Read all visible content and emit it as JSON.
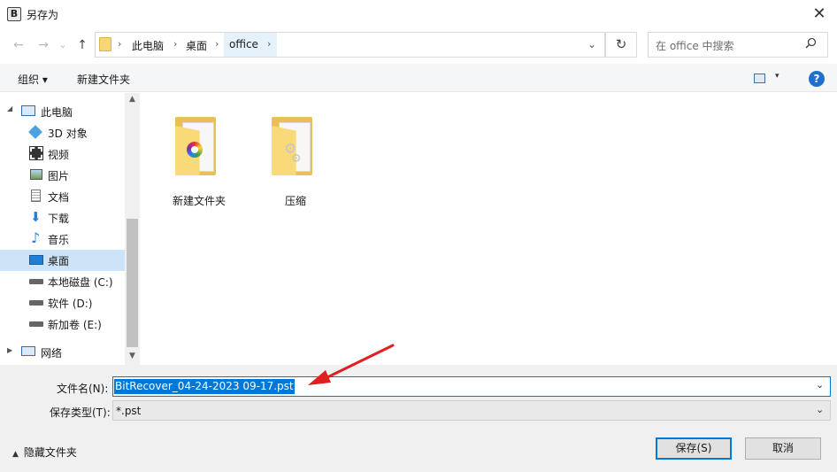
{
  "window": {
    "app_icon_letter": "B",
    "title": "另存为",
    "close_glyph": "✕"
  },
  "address_bar": {
    "back_glyph": "←",
    "forward_glyph": "→",
    "recent_glyph": "⌄",
    "up_glyph": "↑",
    "breadcrumbs": [
      "此电脑",
      "桌面",
      "office"
    ],
    "separator": "›",
    "dropdown_glyph": "⌄",
    "refresh_glyph": "↻"
  },
  "search": {
    "placeholder": "在 office 中搜索",
    "icon": "search-icon"
  },
  "toolbar": {
    "organize_label": "组织 ▾",
    "new_folder_label": "新建文件夹",
    "view_dropdown_glyph": "▾",
    "help_glyph": "?"
  },
  "nav_pane": {
    "items": [
      {
        "label": "此电脑",
        "icon": "computer-icon"
      },
      {
        "label": "3D 对象",
        "icon": "cube-icon"
      },
      {
        "label": "视频",
        "icon": "video-icon"
      },
      {
        "label": "图片",
        "icon": "picture-icon"
      },
      {
        "label": "文档",
        "icon": "document-icon"
      },
      {
        "label": "下载",
        "icon": "download-icon"
      },
      {
        "label": "音乐",
        "icon": "music-icon"
      },
      {
        "label": "桌面",
        "icon": "desktop-icon",
        "selected": true
      },
      {
        "label": "本地磁盘 (C:)",
        "icon": "drive-icon"
      },
      {
        "label": "软件 (D:)",
        "icon": "drive-icon"
      },
      {
        "label": "新加卷 (E:)",
        "icon": "drive-icon"
      },
      {
        "label": "网络",
        "icon": "network-icon"
      }
    ],
    "scroll_up_glyph": "▲",
    "scroll_down_glyph": "▼"
  },
  "content": {
    "folders": [
      {
        "label": "新建文件夹",
        "icon": "folder-icon"
      },
      {
        "label": "压缩",
        "icon": "folder-icon"
      }
    ]
  },
  "form": {
    "filename_label": "文件名(N):",
    "filename_value": "BitRecover_04-24-2023 09-17.pst",
    "filetype_label": "保存类型(T):",
    "filetype_value": "*.pst",
    "dropdown_glyph": "⌄",
    "hide_folders_glyph": "▲",
    "hide_folders_label": "隐藏文件夹"
  },
  "buttons": {
    "save_label": "保存(S)",
    "cancel_label": "取消"
  },
  "colors": {
    "accent": "#0078d7",
    "selection_bg": "#cce4f7",
    "folder_yellow": "#f9d978",
    "annotation_red": "#e02020"
  }
}
